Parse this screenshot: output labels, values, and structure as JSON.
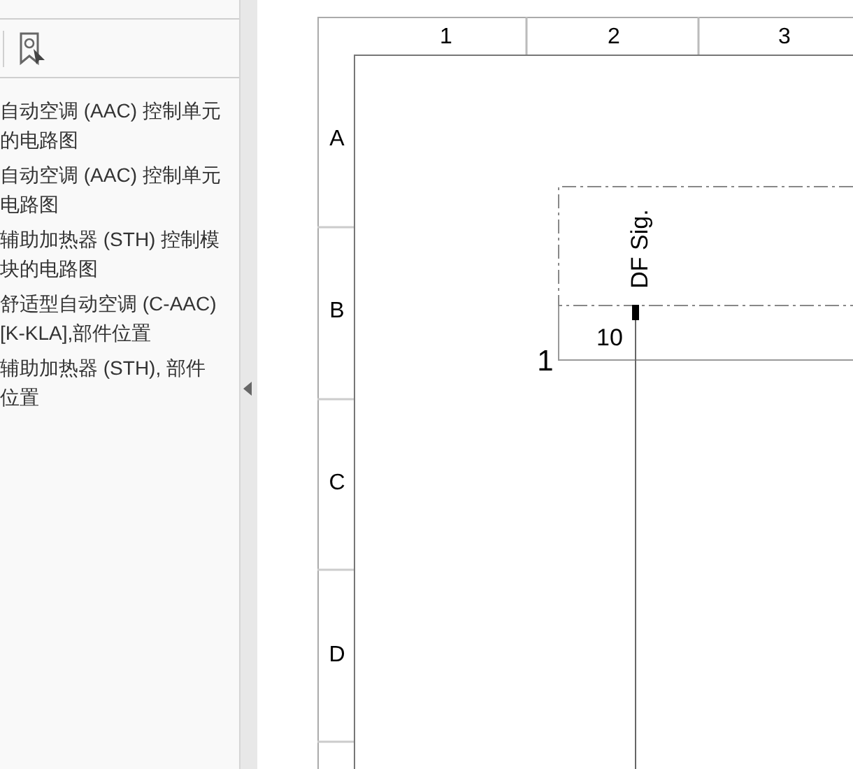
{
  "sidebar": {
    "items": [
      {
        "label": "自动空调 (AAC) 控制单元的电路图",
        "selected": false
      },
      {
        "label": "自动空调 (AAC) 控制单元电路图",
        "selected": false
      },
      {
        "label": "辅助加热器 (STH) 控制模块的电路图",
        "selected": false
      },
      {
        "label": "舒适型自动空调 (C-AAC) [K-KLA],部件位置",
        "selected": false
      },
      {
        "label": "辅助加热器 (STH), 部件位置",
        "selected": false
      }
    ]
  },
  "drawing": {
    "column_labels": [
      "1",
      "2",
      "3"
    ],
    "row_labels": [
      "A",
      "B",
      "C",
      "D"
    ],
    "signal_label": "DF Sig.",
    "pin_number": "10",
    "terminal_number": "1"
  }
}
